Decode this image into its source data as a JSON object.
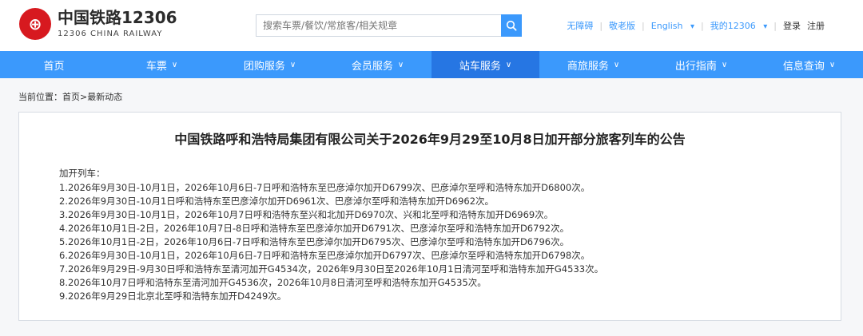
{
  "header": {
    "logo_cn": "中国铁路12306",
    "logo_en": "12306 CHINA RAILWAY",
    "search_placeholder": "搜索车票/餐饮/常旅客/相关规章",
    "links": {
      "accessibility": "无障碍",
      "elderly": "敬老版",
      "language": "English",
      "my12306": "我的12306",
      "login": "登录",
      "register": "注册"
    }
  },
  "nav": {
    "items": [
      {
        "label": "首页",
        "has_chevron": false
      },
      {
        "label": "车票",
        "has_chevron": true
      },
      {
        "label": "团购服务",
        "has_chevron": true
      },
      {
        "label": "会员服务",
        "has_chevron": true
      },
      {
        "label": "站车服务",
        "has_chevron": true,
        "active": true
      },
      {
        "label": "商旅服务",
        "has_chevron": true
      },
      {
        "label": "出行指南",
        "has_chevron": true
      },
      {
        "label": "信息查询",
        "has_chevron": true
      }
    ]
  },
  "breadcrumb": "当前位置：首页>最新动态",
  "notice": {
    "title": "中国铁路呼和浩特局集团有限公司关于2026年9月29至10月8日加开部分旅客列车的公告",
    "intro": "加开列车：",
    "items": [
      "1.2026年9月30日-10月1日，2026年10月6日-7日呼和浩特东至巴彦淖尔加开D6799次、巴彦淖尔至呼和浩特东加开D6800次。",
      "2.2026年9月30日-10月1日呼和浩特东至巴彦淖尔加开D6961次、巴彦淖尔至呼和浩特东加开D6962次。",
      "3.2026年9月30日-10月1日，2026年10月7日呼和浩特东至兴和北加开D6970次、兴和北至呼和浩特东加开D6969次。",
      "4.2026年10月1日-2日，2026年10月7日-8日呼和浩特东至巴彦淖尔加开D6791次、巴彦淖尔至呼和浩特东加开D6792次。",
      "5.2026年10月1日-2日，2026年10月6日-7日呼和浩特东至巴彦淖尔加开D6795次、巴彦淖尔至呼和浩特东加开D6796次。",
      "6.2026年9月30日-10月1日，2026年10月6日-7日呼和浩特东至巴彦淖尔加开D6797次、巴彦淖尔至呼和浩特东加开D6798次。",
      "7.2026年9月29日-9月30日呼和浩特东至清河加开G4534次，2026年9月30日至2026年10月1日清河至呼和浩特东加开G4533次。",
      "8.2026年10月7日呼和浩特东至清河加开G4536次，2026年10月8日清河至呼和浩特东加开G4535次。",
      "9.2026年9月29日北京北至呼和浩特东加开D4249次。"
    ]
  },
  "colors": {
    "nav_bg": "#3b99fc",
    "nav_active": "#2676e3",
    "logo_red": "#d7191f"
  }
}
